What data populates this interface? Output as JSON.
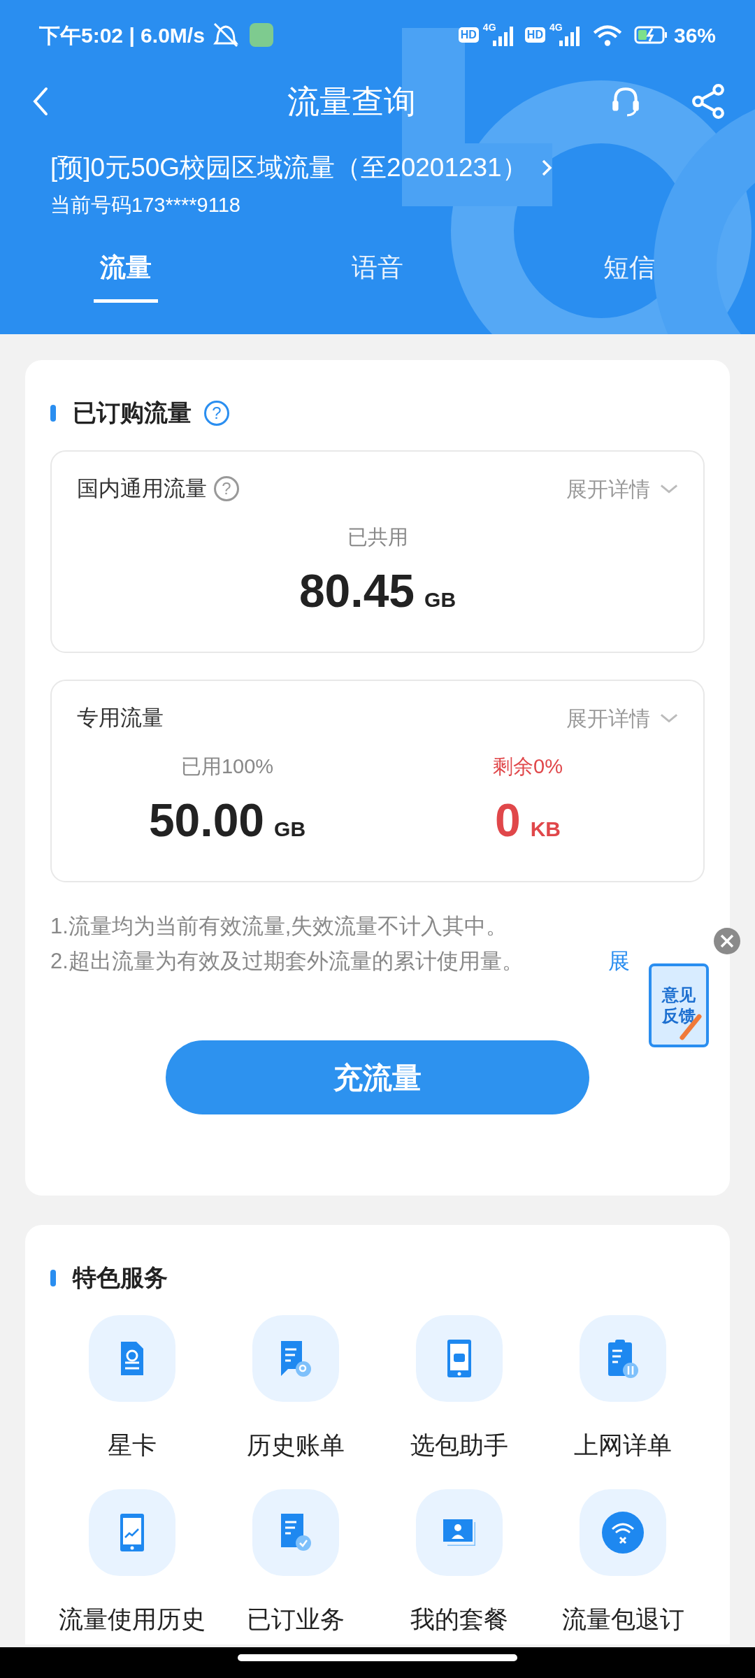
{
  "status_bar": {
    "text": "下午5:02 | 6.0M/s",
    "sims": [
      {
        "badge": "HD",
        "tech": "4G"
      },
      {
        "badge": "HD",
        "tech": "4G"
      }
    ],
    "battery": "36%"
  },
  "header": {
    "title": "流量查询",
    "plan": "[预]0元50G校园区域流量（至20201231）",
    "phone": "当前号码173****9118",
    "tabs": [
      {
        "label": "流量",
        "selected": true
      },
      {
        "label": "语音",
        "selected": false
      },
      {
        "label": "短信",
        "selected": false
      }
    ]
  },
  "ordered": {
    "heading": "已订购流量",
    "help": "?",
    "boxes": [
      {
        "title": "国内通用流量",
        "help": "?",
        "toggle": "展开详情",
        "stats": [
          {
            "label": "已共用",
            "value": "80.45",
            "unit": "GB",
            "kind": "normal"
          }
        ]
      },
      {
        "title": "专用流量",
        "toggle": "展开详情",
        "stats": [
          {
            "label": "已用100%",
            "value": "50.00",
            "unit": "GB",
            "kind": "normal"
          },
          {
            "label": "剩余0%",
            "value": "0",
            "unit": "KB",
            "kind": "alert"
          }
        ]
      }
    ],
    "notes": [
      "1.流量均为当前有效流量,失效流量不计入其中。",
      "2.超出流量为有效及过期套外流量的累计使用量。"
    ],
    "expand_link": "展",
    "button": "充流量"
  },
  "feedback": {
    "lines": [
      "意见",
      "反馈"
    ]
  },
  "services": {
    "heading": "特色服务",
    "items": [
      {
        "label": "星卡",
        "kind": "sim"
      },
      {
        "label": "历史账单",
        "kind": "bill"
      },
      {
        "label": "选包助手",
        "kind": "robot"
      },
      {
        "label": "上网详单",
        "kind": "clipboard"
      },
      {
        "label": "流量使用历史",
        "kind": "chart"
      },
      {
        "label": "已订业务",
        "kind": "check"
      },
      {
        "label": "我的套餐",
        "kind": "profile"
      },
      {
        "label": "流量包退订",
        "kind": "wifi"
      }
    ]
  }
}
